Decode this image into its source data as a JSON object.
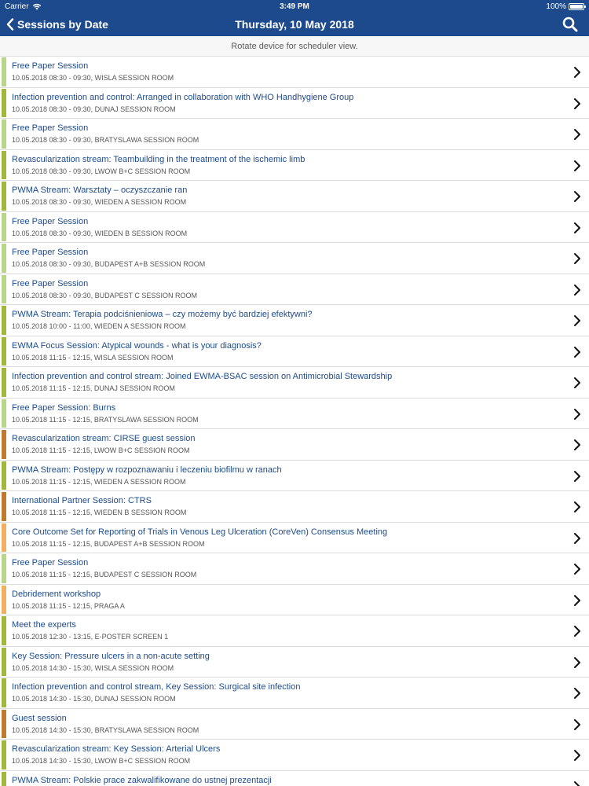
{
  "status_bar": {
    "carrier": "Carrier",
    "time": "3:49 PM",
    "battery": "100%"
  },
  "nav": {
    "back_label": "Sessions by Date",
    "title": "Thursday, 10 May 2018"
  },
  "hint": "Rotate device for scheduler view.",
  "colors": {
    "green": "#a8c64e",
    "light_green": "#b7d68a",
    "olive": "#a0b83a",
    "orange": "#c07a2e",
    "light_orange": "#f0b060",
    "nav_blue": "#1d4a8c"
  },
  "sessions": [
    {
      "title": "Free Paper Session",
      "sub": "10.05.2018 08:30 - 09:30, WISLA SESSION ROOM",
      "color": "#b7d68a"
    },
    {
      "title": "Infection prevention and control: Arranged in collaboration with WHO Handhygiene Group",
      "sub": "10.05.2018 08:30 - 09:30, DUNAJ SESSION ROOM",
      "color": "#a0b83a"
    },
    {
      "title": "Free Paper Session",
      "sub": "10.05.2018 08:30 - 09:30, BRATYSLAWA SESSION ROOM",
      "color": "#b7d68a"
    },
    {
      "title": "Revascularization stream: Teambuilding in the treatment of the ischemic limb",
      "sub": "10.05.2018 08:30 - 09:30, LWOW B+C SESSION ROOM",
      "color": "#a0b83a"
    },
    {
      "title": "PWMA Stream: Warsztaty – oczyszczanie ran",
      "sub": "10.05.2018 08:30 - 09:30, WIEDEN A SESSION ROOM",
      "color": "#a0b83a"
    },
    {
      "title": "Free Paper Session",
      "sub": "10.05.2018 08:30 - 09:30, WIEDEN B SESSION ROOM",
      "color": "#b7d68a"
    },
    {
      "title": "Free Paper Session",
      "sub": "10.05.2018 08:30 - 09:30, BUDAPEST A+B SESSION ROOM",
      "color": "#b7d68a"
    },
    {
      "title": "Free Paper Session",
      "sub": "10.05.2018 08:30 - 09:30, BUDAPEST C SESSION ROOM",
      "color": "#b7d68a"
    },
    {
      "title": "PWMA Stream: Terapia podciśnieniowa – czy możemy być bardziej efektywni?",
      "sub": "10.05.2018 10:00 - 11:00, WIEDEN A SESSION ROOM",
      "color": "#a0b83a"
    },
    {
      "title": "EWMA Focus Session: Atypical wounds - what is your diagnosis?",
      "sub": "10.05.2018 11:15 - 12:15, WISLA SESSION ROOM",
      "color": "#a0b83a"
    },
    {
      "title": "Infection prevention and control stream: Joined EWMA-BSAC session on Antimicrobial Stewardship",
      "sub": "10.05.2018 11:15 - 12:15, DUNAJ SESSION ROOM",
      "color": "#a0b83a"
    },
    {
      "title": "Free Paper Session: Burns",
      "sub": "10.05.2018 11:15 - 12:15, BRATYSLAWA SESSION ROOM",
      "color": "#b7d68a"
    },
    {
      "title": "Revascularization stream: CIRSE guest session",
      "sub": "10.05.2018 11:15 - 12:15, LWOW B+C SESSION ROOM",
      "color": "#c07a2e"
    },
    {
      "title": "PWMA Stream: Postępy w rozpoznawaniu i leczeniu biofilmu w ranach",
      "sub": "10.05.2018 11:15 - 12:15, WIEDEN A SESSION ROOM",
      "color": "#a0b83a"
    },
    {
      "title": "International Partner Session: CTRS",
      "sub": "10.05.2018 11:15 - 12:15, WIEDEN B SESSION ROOM",
      "color": "#c07a2e"
    },
    {
      "title": "Core Outcome Set for Reporting of Trials in Venous Leg Ulceration (CoreVen) Consensus Meeting",
      "sub": "10.05.2018 11:15 - 12:15, BUDAPEST A+B SESSION ROOM",
      "color": "#f0b060"
    },
    {
      "title": "Free Paper Session",
      "sub": "10.05.2018 11:15 - 12:15, BUDAPEST C SESSION ROOM",
      "color": "#b7d68a"
    },
    {
      "title": "Debridement workshop",
      "sub": "10.05.2018 11:15 - 12:15, PRAGA A",
      "color": "#f0b060"
    },
    {
      "title": "Meet the experts",
      "sub": "10.05.2018 12:30 - 13:15, E-POSTER SCREEN 1",
      "color": "#a0b83a"
    },
    {
      "title": "Key Session: Pressure ulcers in a non-acute setting",
      "sub": "10.05.2018 14:30 - 15:30, WISLA SESSION ROOM",
      "color": "#a0b83a"
    },
    {
      "title": "Infection prevention and control stream, Key Session: Surgical site infection",
      "sub": "10.05.2018 14:30 - 15:30, DUNAJ SESSION ROOM",
      "color": "#a0b83a"
    },
    {
      "title": "Guest session",
      "sub": "10.05.2018 14:30 - 15:30, BRATYSLAWA SESSION ROOM",
      "color": "#c07a2e"
    },
    {
      "title": "Revascularization stream: Key Session: Arterial Ulcers",
      "sub": "10.05.2018 14:30 - 15:30, LWOW B+C SESSION ROOM",
      "color": "#a0b83a"
    },
    {
      "title": "PWMA Stream: Polskie prace zakwalifikowane do ustnej prezentacji",
      "sub": "",
      "color": "#a0b83a"
    }
  ]
}
